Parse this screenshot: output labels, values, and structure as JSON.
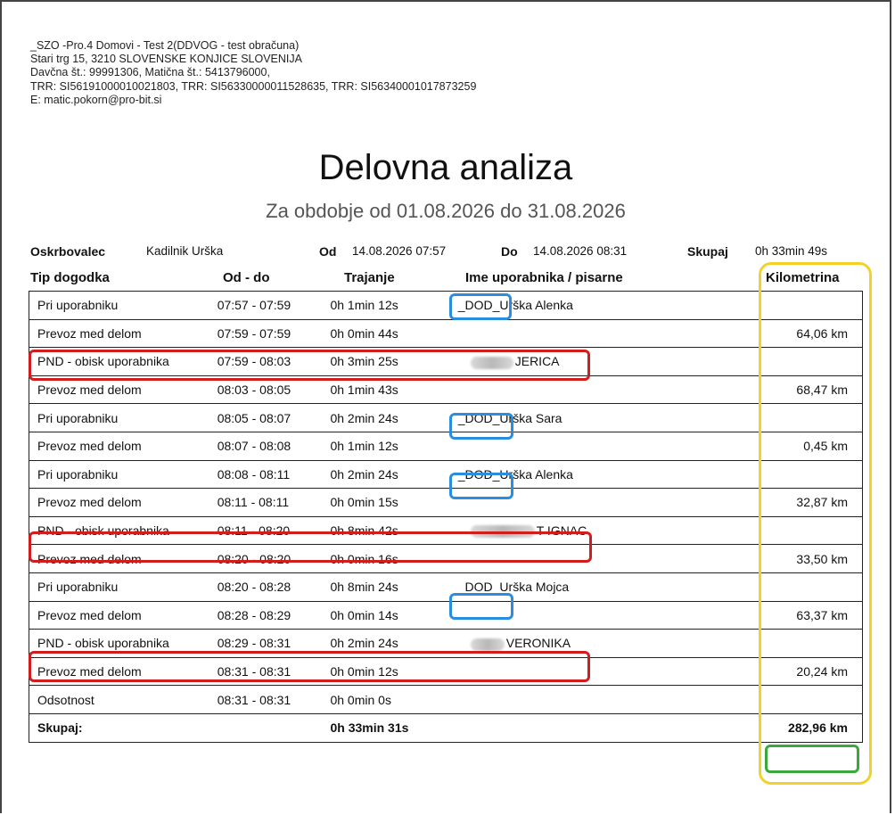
{
  "company": {
    "line1": "_SZO -Pro.4 Domovi - Test 2(DDVOG - test obračuna)",
    "line2": "Stari trg 15, 3210 SLOVENSKE KONJICE SLOVENIJA",
    "line3": "Davčna št.: 99991306, Matična št.: 5413796000,",
    "line4": "TRR: SI56191000010021803, TRR: SI56330000011528635, TRR: SI56340001017873259",
    "line5": "E: matic.pokorn@pro-bit.si"
  },
  "title": "Delovna analiza",
  "subtitle": "Za obdobje od 01.08.2026 do 31.08.2026",
  "summary": {
    "caregiver_label": "Oskrbovalec",
    "caregiver_value": "Kadilnik Urška",
    "from_label": "Od",
    "from_value": "14.08.2026 07:57",
    "to_label": "Do",
    "to_value": "14.08.2026 08:31",
    "total_label": "Skupaj",
    "total_value": "0h 33min 49s"
  },
  "headers": {
    "type": "Tip dogodka",
    "range": "Od - do",
    "duration": "Trajanje",
    "name": "Ime uporabnika / pisarne",
    "km": "Kilometrina"
  },
  "rows": [
    {
      "type": "Pri uporabniku",
      "range": "07:57 - 07:59",
      "duration": "0h 1min 12s",
      "name": "_DOD_Urška Alenka",
      "km": ""
    },
    {
      "type": "Prevoz med delom",
      "range": "07:59 - 07:59",
      "duration": "0h 0min 44s",
      "name": "",
      "km": "64,06 km"
    },
    {
      "type": "PND - obisk uporabnika",
      "range": "07:59 - 08:03",
      "duration": "0h 3min 25s",
      "name": "JERICA",
      "km": ""
    },
    {
      "type": "Prevoz med delom",
      "range": "08:03 - 08:05",
      "duration": "0h 1min 43s",
      "name": "",
      "km": "68,47 km"
    },
    {
      "type": "Pri uporabniku",
      "range": "08:05 - 08:07",
      "duration": "0h 2min 24s",
      "name": "_DOD_Urška Sara",
      "km": ""
    },
    {
      "type": "Prevoz med delom",
      "range": "08:07 - 08:08",
      "duration": "0h 1min 12s",
      "name": "",
      "km": "0,45 km"
    },
    {
      "type": "Pri uporabniku",
      "range": "08:08 - 08:11",
      "duration": "0h 2min 24s",
      "name": "_DOD_Urška Alenka",
      "km": ""
    },
    {
      "type": "Prevoz med delom",
      "range": "08:11 - 08:11",
      "duration": "0h 0min 15s",
      "name": "",
      "km": "32,87 km"
    },
    {
      "type": "PND - obisk uporabnika",
      "range": "08:11 - 08:20",
      "duration": "0h 8min 42s",
      "name": "T IGNAC",
      "km": ""
    },
    {
      "type": "Prevoz med delom",
      "range": "08:20 - 08:20",
      "duration": "0h 0min 16s",
      "name": "",
      "km": "33,50 km"
    },
    {
      "type": "Pri uporabniku",
      "range": "08:20 - 08:28",
      "duration": "0h 8min 24s",
      "name": "_DOD_Urška Mojca",
      "km": ""
    },
    {
      "type": "Prevoz med delom",
      "range": "08:28 - 08:29",
      "duration": "0h 0min 14s",
      "name": "",
      "km": "63,37 km"
    },
    {
      "type": "PND - obisk uporabnika",
      "range": "08:29 - 08:31",
      "duration": "0h 2min 24s",
      "name": "VERONIKA",
      "km": ""
    },
    {
      "type": "Prevoz med delom",
      "range": "08:31 - 08:31",
      "duration": "0h 0min 12s",
      "name": "",
      "km": "20,24 km"
    },
    {
      "type": "Odsotnost",
      "range": "08:31 - 08:31",
      "duration": "0h 0min 0s",
      "name": "",
      "km": ""
    }
  ],
  "total": {
    "label": "Skupaj:",
    "duration": "0h 33min 31s",
    "km": "282,96 km"
  },
  "colors": {
    "annotation_red": "#d11d1d",
    "annotation_blue": "#2a8de0",
    "annotation_yellow": "#f2d22a",
    "annotation_green": "#3aa83a"
  }
}
